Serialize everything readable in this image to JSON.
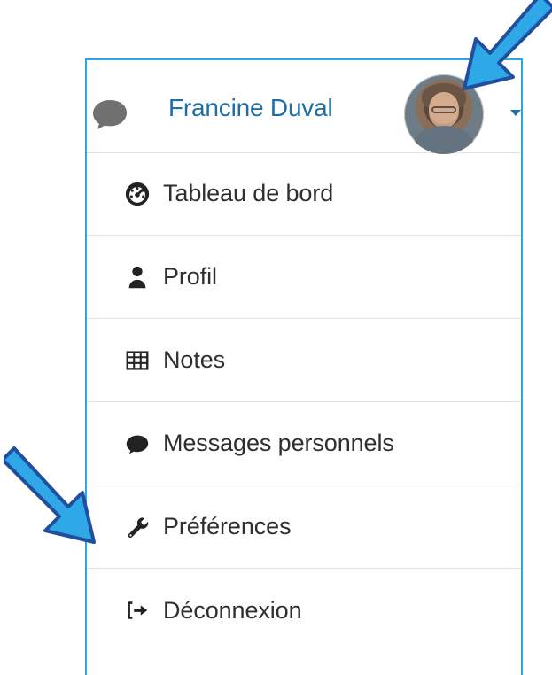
{
  "header": {
    "user_name": "Francine Duval",
    "avatar_label": "Francine Duval avatar"
  },
  "menu": {
    "items": [
      {
        "label": "Tableau de bord",
        "icon": "dashboard-icon"
      },
      {
        "label": "Profil",
        "icon": "user-icon"
      },
      {
        "label": "Notes",
        "icon": "table-grid-icon"
      },
      {
        "label": "Messages personnels",
        "icon": "speech-bubble-icon"
      },
      {
        "label": "Préférences",
        "icon": "wrench-icon"
      },
      {
        "label": "Déconnexion",
        "icon": "sign-out-icon"
      }
    ]
  },
  "colors": {
    "panel_border": "#29a8e0",
    "user_name": "#1f6ea6",
    "menu_text": "#2f2f2f",
    "arrow_fill": "#2ea8e6",
    "arrow_stroke": "#214f9f"
  }
}
